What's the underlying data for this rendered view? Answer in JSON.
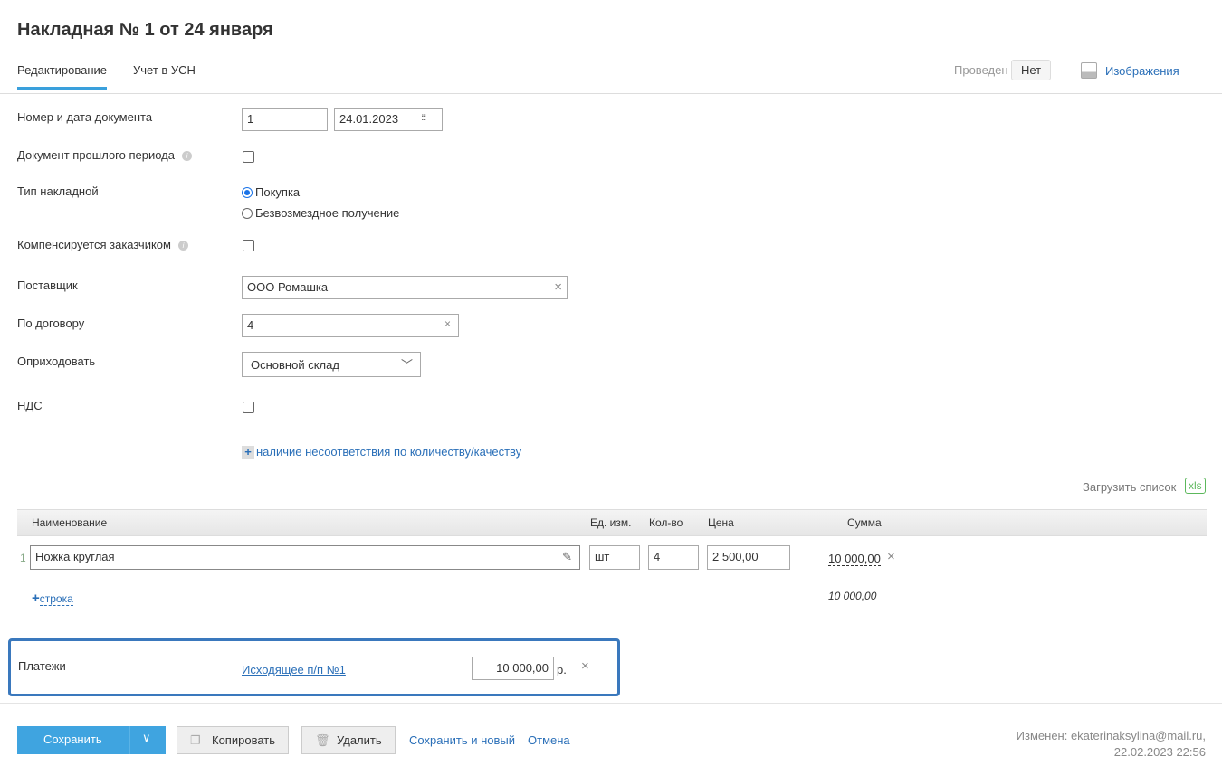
{
  "title": "Накладная № 1 от 24 января",
  "tabs": [
    {
      "label": "Редактирование"
    },
    {
      "label": "Учет в УСН"
    }
  ],
  "status": {
    "label": "Проведен",
    "value": "Нет"
  },
  "images_link": "Изображения",
  "form": {
    "doc_number_label": "Номер и дата документа",
    "doc_number": "1",
    "doc_date": "24.01.2023",
    "past_period_label": "Документ прошлого периода",
    "type_label": "Тип накладной",
    "type_options": [
      "Покупка",
      "Безвозмездное получение"
    ],
    "compensated_label": "Компенсируется заказчиком",
    "supplier_label": "Поставщик",
    "supplier": "ООО Ромашка",
    "contract_label": "По договору",
    "contract": "4",
    "stock_label": "Оприходовать",
    "stock": "Основной склад",
    "vat_label": "НДС",
    "mismatch_link": "наличие несоответствия по количеству/качеству"
  },
  "table": {
    "upload_label": "Загрузить список",
    "xls": "xls",
    "headers": [
      "Наименование",
      "Ед. изм.",
      "Кол-во",
      "Цена",
      "Сумма"
    ],
    "rows": [
      {
        "n": "1",
        "name": "Ножка круглая",
        "unit": "шт",
        "qty": "4",
        "price": "2 500,00",
        "sum": "10 000,00"
      }
    ],
    "add_row": "строка",
    "total": "10 000,00"
  },
  "payments": {
    "label": "Платежи",
    "link": "Исходящее п/п №1",
    "amount": "10 000,00",
    "currency": "р."
  },
  "footer": {
    "save": "Сохранить",
    "copy": "Копировать",
    "delete": "Удалить",
    "save_new": "Сохранить и новый",
    "cancel": "Отмена",
    "modified": "Изменен: ekaterinaksylina@mail.ru,",
    "modified_date": "22.02.2023 22:56"
  }
}
